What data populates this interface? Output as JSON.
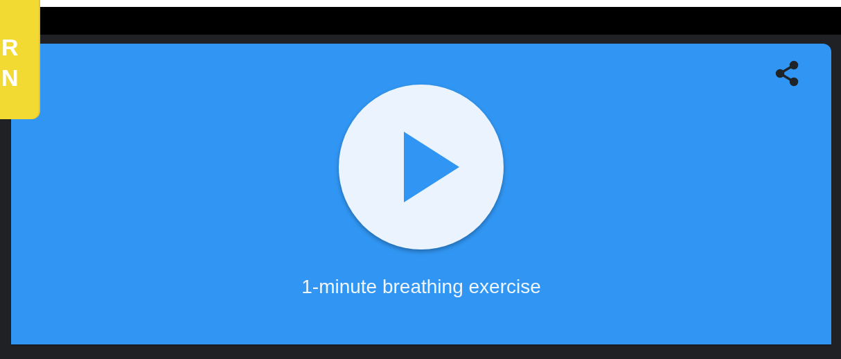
{
  "badge": {
    "lines": [
      "R",
      "N"
    ]
  },
  "player": {
    "title": "1-minute breathing exercise"
  }
}
